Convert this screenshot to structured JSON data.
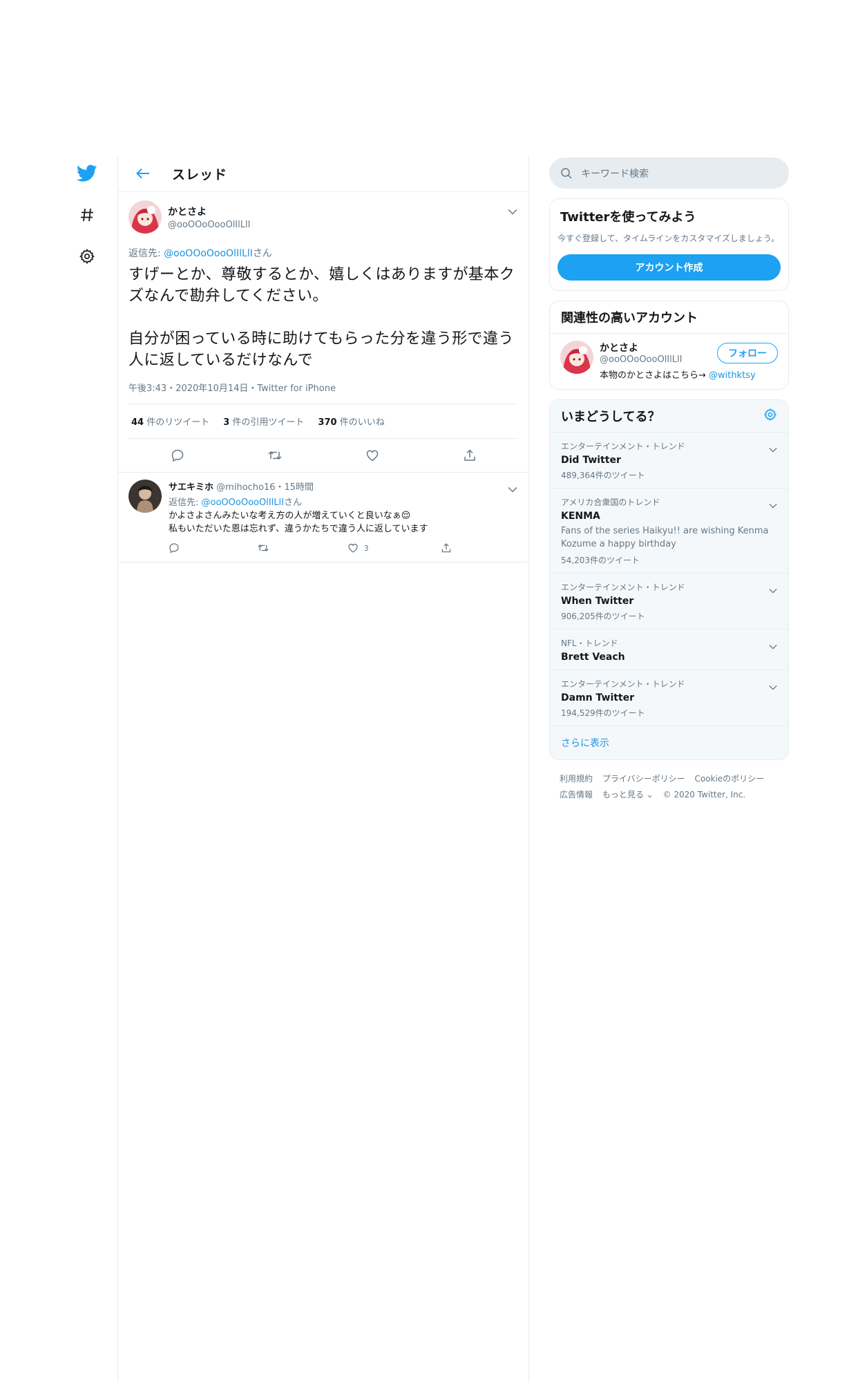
{
  "header": {
    "title": "スレッド"
  },
  "tweet": {
    "display_name": "かとさよ",
    "username": "@ooOOoOooOlIlLlI",
    "reply_prefix": "返信先: ",
    "reply_handle": "@ooOOoOooOlIlLlI",
    "reply_suffix": "さん",
    "text": "すげーとか、尊敬するとか、嬉しくはありますが基本クズなんで勘弁してください。\n\n自分が困っている時に助けてもらった分を違う形で違う人に返しているだけなんで",
    "meta": "午後3:43・2020年10月14日・Twitter for iPhone",
    "retweets_count": "44",
    "retweets_label": " 件のリツイート",
    "quotes_count": "3",
    "quotes_label": " 件の引用ツイート",
    "likes_count": "370",
    "likes_label": " 件のいいね"
  },
  "reply": {
    "display_name": "サエキミホ",
    "username": "@mihocho16・15時間",
    "reply_prefix": "返信先: ",
    "reply_handle": "@ooOOoOooOlIlLlI",
    "reply_suffix": "さん",
    "line1": "かよさよさんみたいな考え方の人が増えていくと良いなぁ😌",
    "line2": "私もいただいた恩は忘れず、違うかたちで違う人に返しています",
    "likes": "3"
  },
  "sidebar": {
    "search_placeholder": "キーワード検索",
    "signup_title": "Twitterを使ってみよう",
    "signup_desc": "今すぐ登録して、タイムラインをカスタマイズしましょう。",
    "signup_button": "アカウント作成",
    "related_title": "関連性の高いアカウント",
    "related_account": {
      "display_name": "かとさよ",
      "username": "@ooOOoOooOlIlLlI",
      "bio": "本物のかとさよはこちら→ ",
      "bio_link": "@withktsy",
      "follow_label": "フォロー"
    },
    "trends_title": "いまどうしてる？",
    "trends": [
      {
        "context": "エンターテインメント・トレンド",
        "name": "Did Twitter",
        "count": "489,364件のツイート"
      },
      {
        "context": "アメリカ合衆国のトレンド",
        "name": "KENMA",
        "desc": "Fans of the series Haikyu!! are wishing Kenma Kozume a happy birthday",
        "count": "54,203件のツイート"
      },
      {
        "context": "エンターテインメント・トレンド",
        "name": "When Twitter",
        "count": "906,205件のツイート"
      },
      {
        "context": "NFL・トレンド",
        "name": "Brett Veach"
      },
      {
        "context": "エンターテインメント・トレンド",
        "name": "Damn Twitter",
        "count": "194,529件のツイート"
      }
    ],
    "show_more": "さらに表示",
    "footer": {
      "terms": "利用規約",
      "privacy": "プライバシーポリシー",
      "cookies": "Cookieのポリシー",
      "ads": "広告情報",
      "more": "もっと見る ⌄",
      "copyright": "© 2020 Twitter, Inc."
    }
  },
  "colors": {
    "accent": "#1da1f2",
    "link": "#1b95e0",
    "muted": "#657786",
    "border": "#e6ecf0"
  }
}
